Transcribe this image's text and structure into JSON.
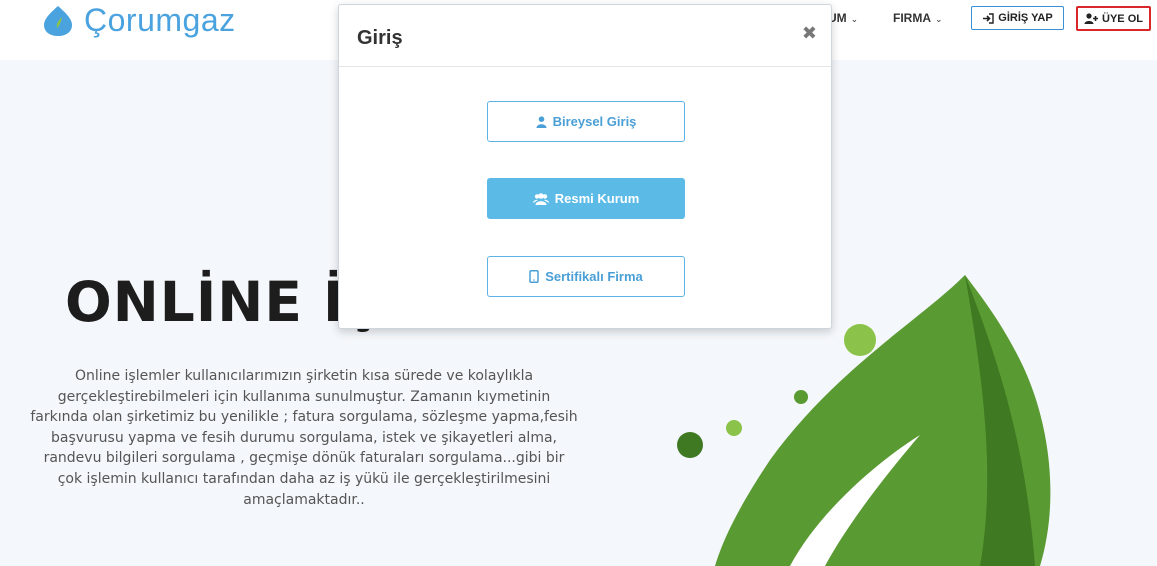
{
  "header": {
    "logo_text": "Çorumgaz",
    "nav_items": [
      {
        "label": "UM",
        "icon": "chevron-down-icon"
      },
      {
        "label": "FIRMA",
        "icon": "chevron-down-icon"
      }
    ],
    "login_button": {
      "label": "GİRİŞ YAP",
      "icon": "sign-in-icon"
    },
    "register_button": {
      "label": "ÜYE OL",
      "icon": "user-plus-icon"
    }
  },
  "hero": {
    "title": "ONLİNE İŞ",
    "text": "Online işlemler kullanıcılarımızın şirketin kısa sürede ve kolaylıkla gerçekleştirebilmeleri için kullanıma sunulmuştur. Zamanın kıymetinin farkında olan şirketimiz bu yenilikle ; fatura sorgulama, sözleşme yapma,fesih başvurusu yapma ve fesih durumu sorgulama, istek ve şikayetleri alma, randevu bilgileri sorgulama , geçmişe dönük faturaları sorgulama...gibi bir çok işlemin kullanıcı tarafından daha az iş yükü ile gerçekleştirilmesini amaçlamaktadır.."
  },
  "modal": {
    "title": "Giriş",
    "close_label": "✖",
    "options": [
      {
        "label": "Bireysel Giriş",
        "icon": "user-icon"
      },
      {
        "label": "Resmi Kurum",
        "icon": "users-icon"
      },
      {
        "label": "Sertifikalı Firma",
        "icon": "tablet-icon"
      }
    ]
  },
  "colors": {
    "brand_blue": "#4aa3df",
    "button_blue": "#5bbae6",
    "register_border": "#d9262a",
    "leaf_green": "#5a9a32"
  }
}
